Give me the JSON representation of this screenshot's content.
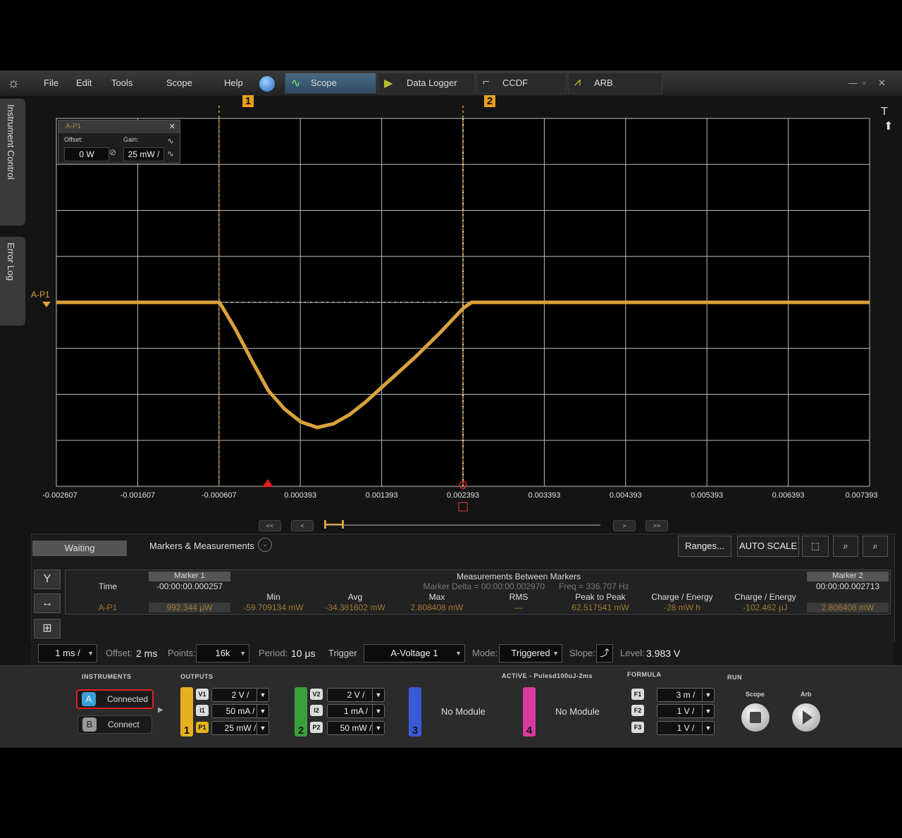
{
  "menu": {
    "items": [
      "File",
      "Edit",
      "Tools",
      "Scope",
      "Help"
    ],
    "tabs": [
      "Scope",
      "Data Logger",
      "CCDF",
      "ARB"
    ]
  },
  "side_tabs": [
    "Instrument Control",
    "Error Log"
  ],
  "channel_box": {
    "title": "A-P1",
    "offset_label": "Offset:",
    "gain_label": "Gain:",
    "offset_value": "0 W",
    "gain_value": "25 mW /"
  },
  "trace_label": "A-P1",
  "markers": [
    "1",
    "2"
  ],
  "plot_corner_label": "T",
  "chart_data": {
    "type": "line",
    "x_tick_labels": [
      "-0.002607",
      "-0.001607",
      "-0.000607",
      "0.000393",
      "0.001393",
      "0.002393",
      "0.003393",
      "0.004393",
      "0.005393",
      "0.006393",
      "0.007393"
    ],
    "xlim": [
      -0.002607,
      0.007393
    ],
    "ylim": [
      -100,
      100
    ],
    "grid": true,
    "marker_positions": [
      -0.000607,
      0.002393
    ],
    "series": [
      {
        "name": "A-P1",
        "color": "#d9a23a",
        "x": [
          -0.002607,
          -0.001,
          -0.0006,
          -0.0004,
          -0.0002,
          0.0,
          0.0002,
          0.0004,
          0.0006,
          0.0008,
          0.001,
          0.0012,
          0.0015,
          0.0018,
          0.0021,
          0.0024,
          0.0025,
          0.004,
          0.007393
        ],
        "y": [
          0,
          0,
          0,
          -15,
          -32,
          -48,
          -58,
          -65,
          -68,
          -66,
          -61,
          -54,
          -42,
          -30,
          -17,
          -3,
          0,
          0,
          0
        ]
      }
    ]
  },
  "scroll": {
    "left": [
      "<<",
      "<"
    ],
    "right": [
      ">",
      ">>"
    ]
  },
  "measure_panel": {
    "status": "Waiting",
    "title": "Markers & Measurements",
    "buttons": {
      "ranges": "Ranges...",
      "auto_scale": "AUTO SCALE"
    },
    "marker1_label": "Marker 1",
    "marker1_time": "-00:00:00.000257",
    "marker2_label": "Marker 2",
    "marker2_time": "00:00:00.002713",
    "between_title": "Measurements Between Markers",
    "marker_delta": "Marker Delta = 00:00:00.002970",
    "freq": "Freq = 336.707 Hz",
    "row_time": "Time",
    "row_channel": "A-P1",
    "columns": [
      "Min",
      "Avg",
      "Max",
      "RMS",
      "Peak to Peak",
      "Charge / Energy",
      "Charge / Energy"
    ],
    "marker1_value": "992.344 μW",
    "values": [
      "-59.709134 mW",
      "-34.381602 mW",
      "2.808408 mW",
      "—",
      "62.517541 mW",
      "-28 mW h",
      "-102.462 μJ"
    ],
    "marker2_value": "2.808408 mW"
  },
  "settings": {
    "timebase": "1 ms /",
    "offset_label": "Offset:",
    "offset_value": "2 ms",
    "points_label": "Points:",
    "points_value": "16k",
    "period_label": "Period:",
    "period_value": "10 μs",
    "trigger_label": "Trigger",
    "trigger_value": "A-Voltage 1",
    "mode_label": "Mode:",
    "mode_value": "Triggered",
    "slope_label": "Slope:",
    "level_label": "Level:",
    "level_value": "3.983 V"
  },
  "instruments": {
    "title": "INSTRUMENTS",
    "a_letter": "A",
    "a_label": "Connected",
    "b_letter": "B",
    "b_label": "Connect"
  },
  "outputs": {
    "title": "OUTPUTS",
    "active_label": "ACTIVE - Pulesd100uJ-2ms",
    "ch1": {
      "num": "1",
      "rows": [
        [
          "V1",
          "2 V /"
        ],
        [
          "I1",
          "50 mA /"
        ],
        [
          "P1",
          "25 mW /"
        ]
      ]
    },
    "ch2": {
      "num": "2",
      "rows": [
        [
          "V2",
          "2 V /"
        ],
        [
          "I2",
          "1 mA /"
        ],
        [
          "P2",
          "50 mW /"
        ]
      ]
    },
    "ch3": {
      "num": "3",
      "label": "No Module"
    },
    "ch4": {
      "num": "4",
      "label": "No Module"
    }
  },
  "formula": {
    "title": "FORMULA",
    "rows": [
      [
        "F1",
        "3 m /"
      ],
      [
        "F2",
        "1 V /"
      ],
      [
        "F3",
        "1 V /"
      ]
    ]
  },
  "run": {
    "title": "RUN",
    "scope": "Scope",
    "arb": "Arb"
  }
}
